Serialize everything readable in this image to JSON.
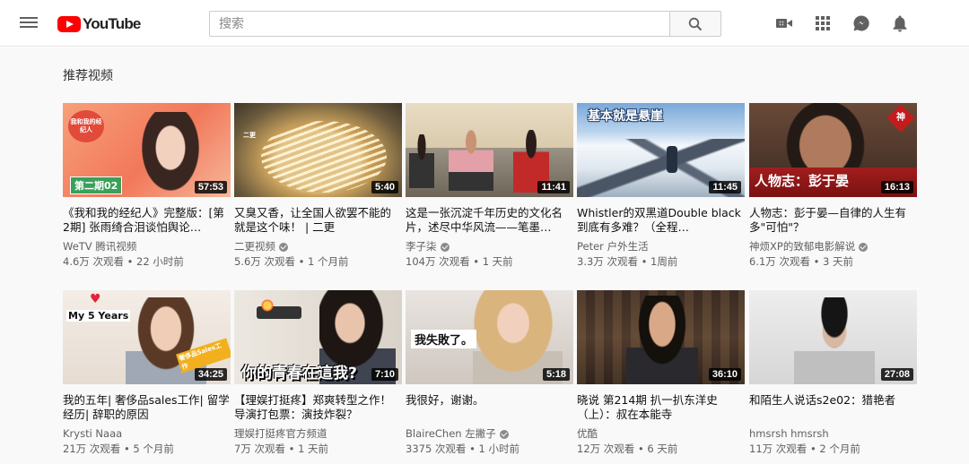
{
  "header": {
    "logo_text": "YouTube",
    "search_placeholder": "搜索"
  },
  "section": {
    "title": "推荐视频"
  },
  "videos": [
    {
      "title": "《我和我的经纪人》完整版：[第2期] 张雨绮合泪谈怕舆论…",
      "channel": "WeTV 腾讯视频",
      "verified": false,
      "meta": "4.6万 次观看 • 22 小时前",
      "duration": "57:53",
      "overlay": "第二期02",
      "badge": "我和我的经纪人"
    },
    {
      "title": "又臭又香，让全国人欲罢不能的就是这个味！ | 二更",
      "channel": "二更视频",
      "verified": true,
      "meta": "5.6万 次观看 • 1 个月前",
      "duration": "5:40",
      "overlay": "",
      "badge": "二更"
    },
    {
      "title": "这是一张沉淀千年历史的文化名片，述尽中华风流——笔墨…",
      "channel": "李子柒",
      "verified": true,
      "meta": "104万 次观看 • 1 天前",
      "duration": "11:41",
      "overlay": "",
      "badge": ""
    },
    {
      "title": "Whistler的双黑道Double black 到底有多难？（全程…",
      "channel": "Peter 户外生活",
      "verified": false,
      "meta": "3.3万 次观看 • 1周前",
      "duration": "11:45",
      "overlay": "基本就是悬崖",
      "badge": ""
    },
    {
      "title": "人物志：彭于晏—自律的人生有多\"可怕\"？",
      "channel": "神烦XP的致郁电影解说",
      "verified": true,
      "meta": "6.1万 次观看 • 3 天前",
      "duration": "16:13",
      "overlay": "人物志：彭于晏",
      "badge": "神"
    },
    {
      "title": "我的五年| 奢侈品sales工作| 留学经历| 辞职的原因",
      "channel": "Krysti Naaa",
      "verified": false,
      "meta": "21万 次观看 • 5 个月前",
      "duration": "34:25",
      "overlay": "My 5 Years",
      "badge": "奢侈品Sales工作"
    },
    {
      "title": "【理娱打挺疼】郑爽转型之作！导演打包票：演技炸裂？",
      "channel": "理娱打挺疼官方频道",
      "verified": false,
      "meta": "7万 次观看 • 1 天前",
      "duration": "7:10",
      "overlay": "你的青春在這我?",
      "badge": ""
    },
    {
      "title": "我很好，谢谢。",
      "channel": "BlaireChen 左撇子",
      "verified": true,
      "meta": "3375 次观看 • 1 小时前",
      "duration": "5:18",
      "overlay": "我失敗了。",
      "badge": ""
    },
    {
      "title": "晓说 第214期 扒一扒东洋史（上）：叔在本能寺",
      "channel": "优酷",
      "verified": false,
      "meta": "12万 次观看 • 6 天前",
      "duration": "36:10",
      "overlay": "",
      "badge": ""
    },
    {
      "title": "和陌生人说话s2e02：猎艳者",
      "channel": "hmsrsh hmsrsh",
      "verified": false,
      "meta": "11万 次观看 • 2 个月前",
      "duration": "27:08",
      "overlay": "",
      "badge": ""
    }
  ],
  "colors": {
    "brand_red": "#ff0000",
    "text_secondary": "#606060",
    "page_bg": "#f9f9f9"
  },
  "icons": [
    "menu-icon",
    "youtube-logo-icon",
    "search-icon",
    "create-video-icon",
    "apps-grid-icon",
    "messages-icon",
    "notifications-bell-icon"
  ]
}
